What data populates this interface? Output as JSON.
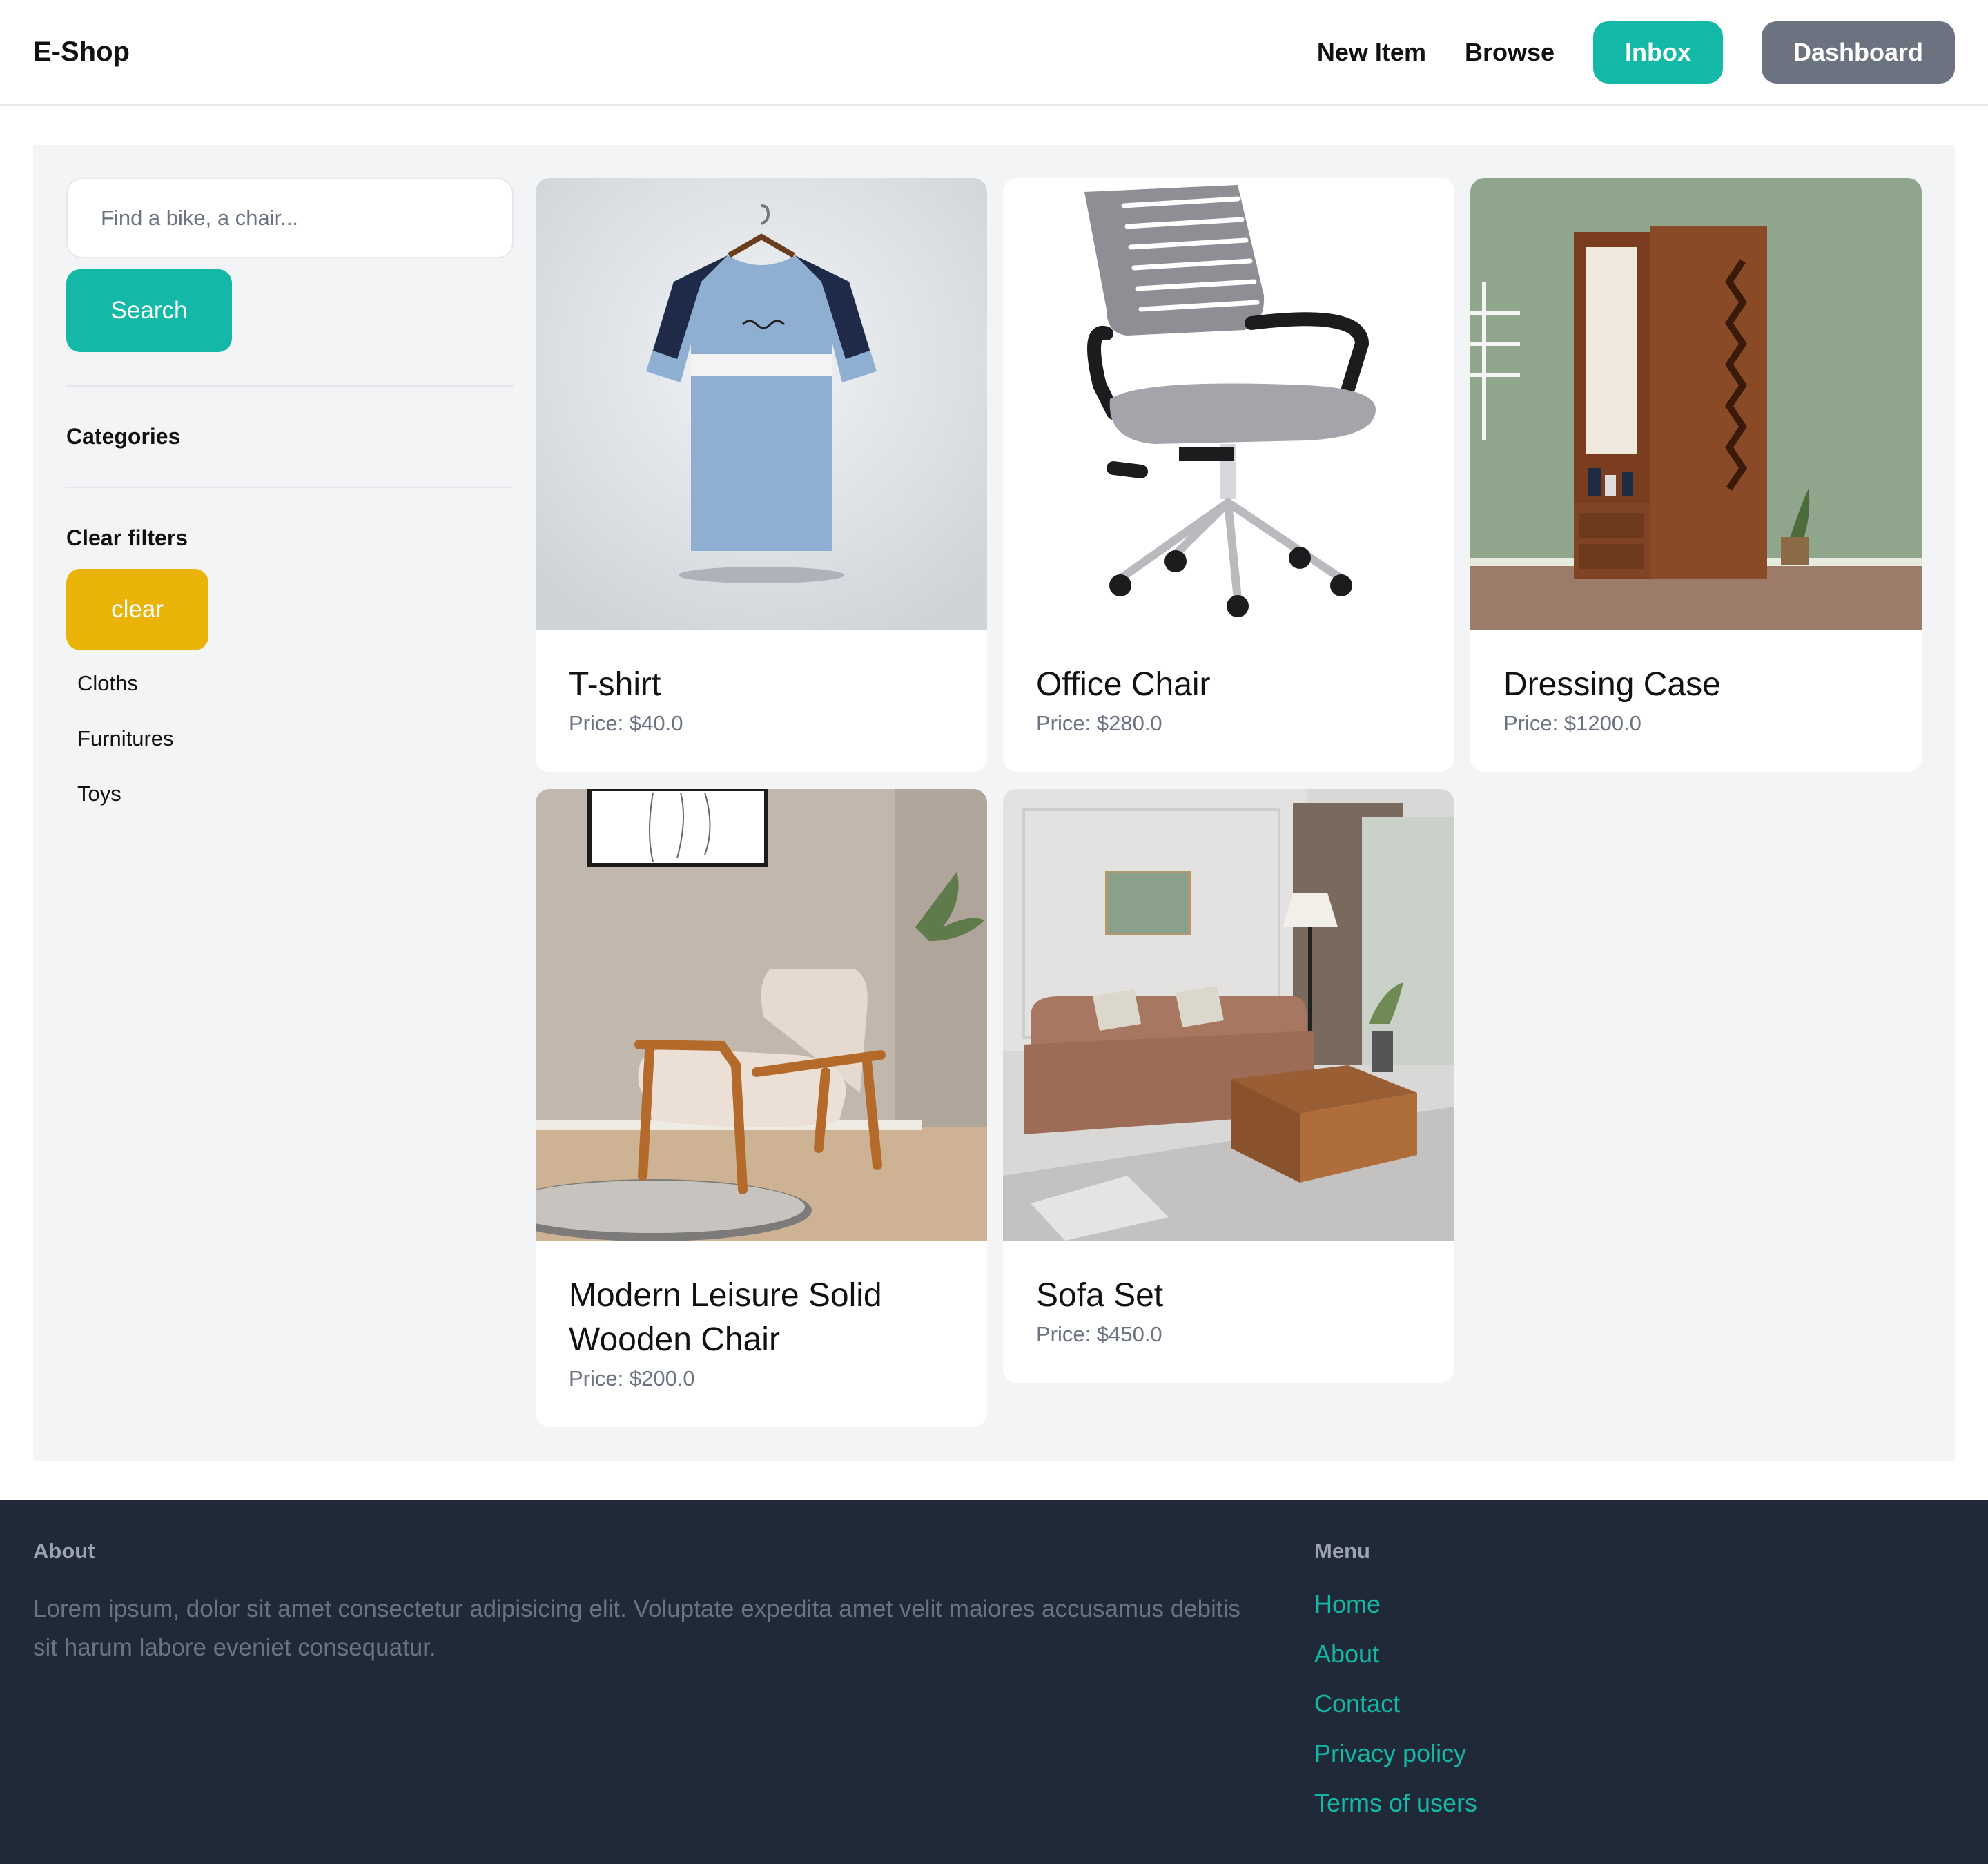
{
  "nav": {
    "brand": "E-Shop",
    "new_item": "New Item",
    "browse": "Browse",
    "inbox": "Inbox",
    "dashboard": "Dashboard"
  },
  "sidebar": {
    "search_placeholder": "Find a bike, a chair...",
    "search_button": "Search",
    "categories_title": "Categories",
    "clear_filters_title": "Clear filters",
    "clear_button": "clear",
    "categories": [
      "Cloths",
      "Furnitures",
      "Toys"
    ]
  },
  "items": [
    {
      "name": "T-shirt",
      "price": "Price: $40.0",
      "image": "tshirt"
    },
    {
      "name": "Office Chair",
      "price": "Price: $280.0",
      "image": "office-chair"
    },
    {
      "name": "Dressing Case",
      "price": "Price: $1200.0",
      "image": "dressing-case"
    },
    {
      "name": "Modern Leisure Solid Wooden Chair",
      "price": "Price: $200.0",
      "image": "armchair"
    },
    {
      "name": "Sofa Set",
      "price": "Price: $450.0",
      "image": "sofa-set"
    }
  ],
  "footer": {
    "about_title": "About",
    "about_text": "Lorem ipsum, dolor sit amet consectetur adipisicing elit. Voluptate expedita amet velit maiores accusamus debitis sit harum labore eveniet consequatur.",
    "menu_title": "Menu",
    "menu": [
      "Home",
      "About",
      "Contact",
      "Privacy policy",
      "Terms of users"
    ]
  },
  "colors": {
    "accent": "#14b8a6",
    "clear": "#eab308",
    "dashboard": "#6b7280",
    "footer_bg": "#1f2937"
  }
}
